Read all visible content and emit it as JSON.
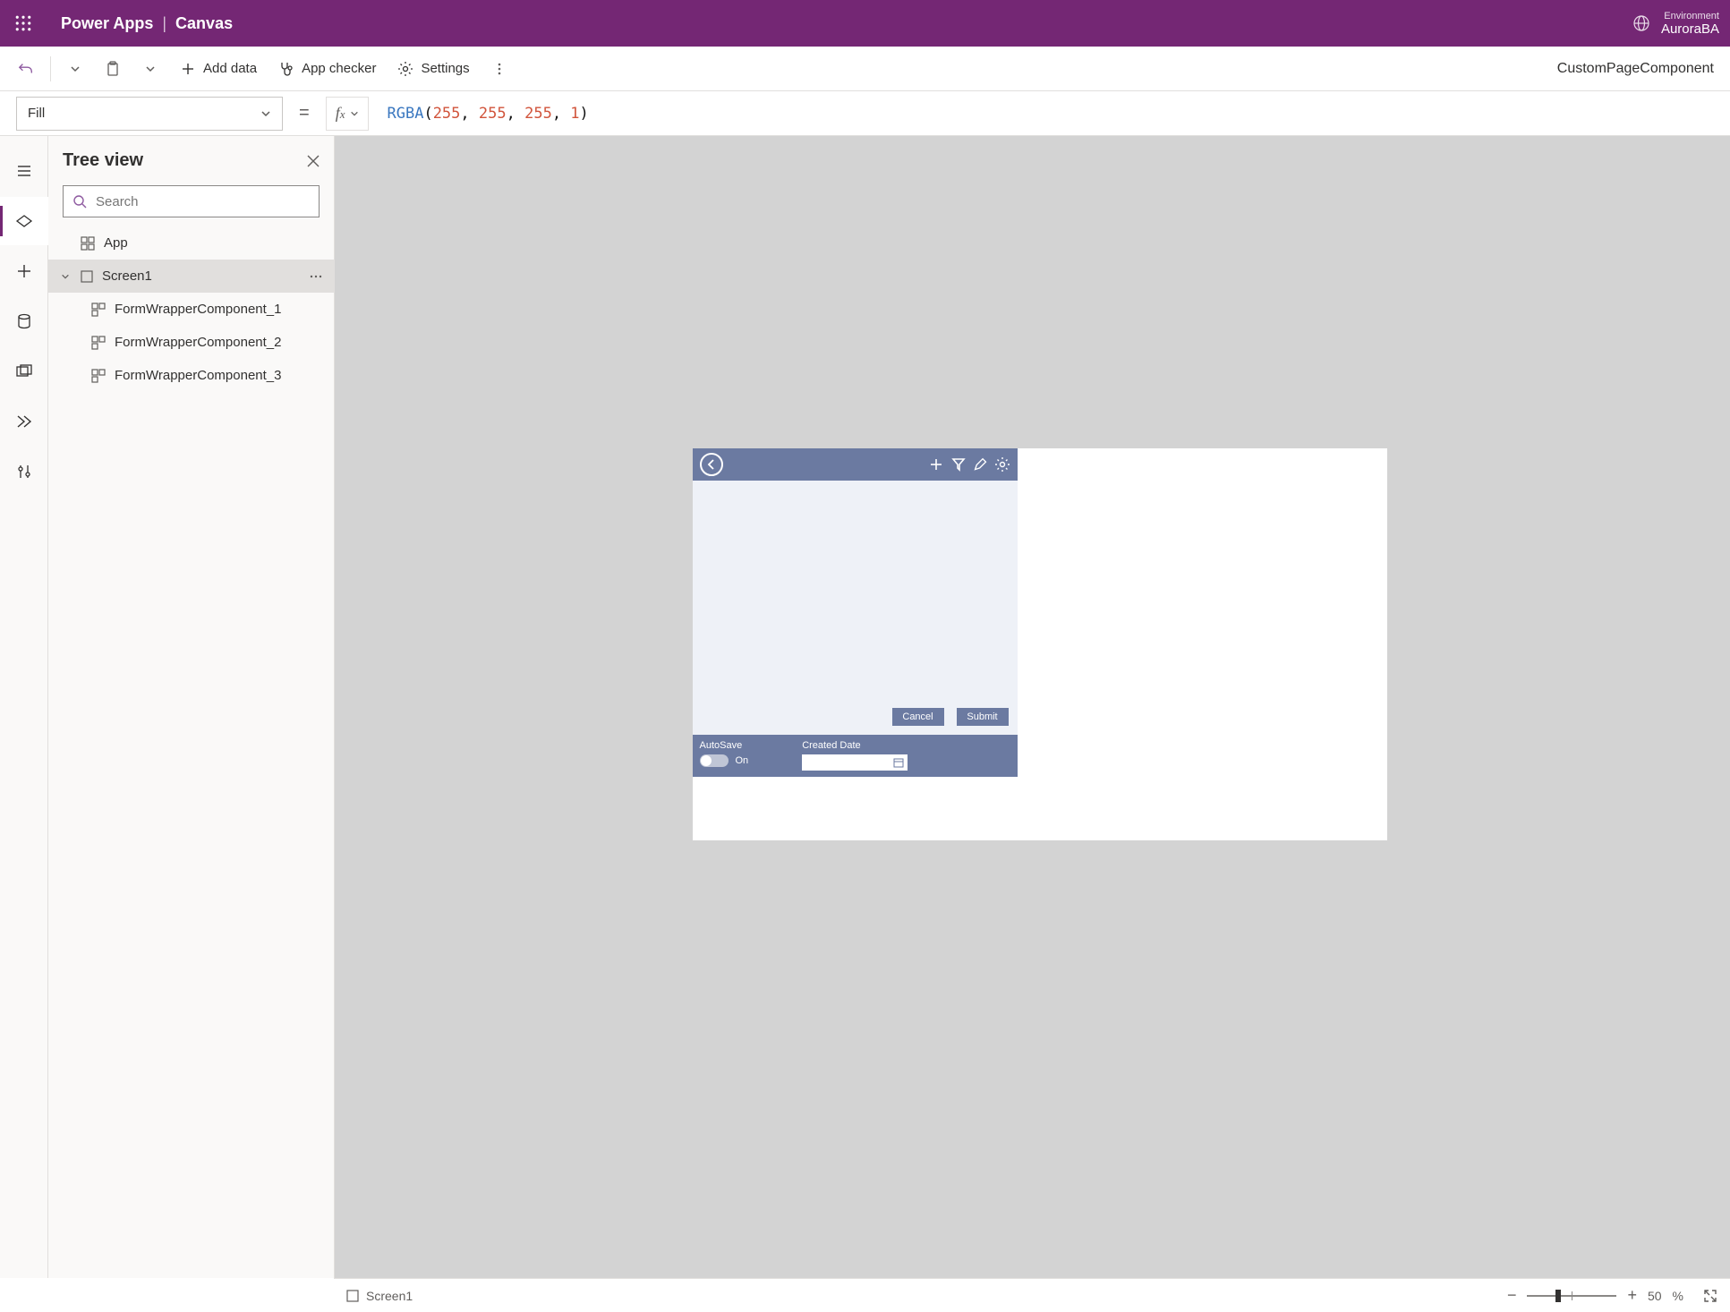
{
  "header": {
    "app_name": "Power Apps",
    "context": "Canvas",
    "env_label": "Environment",
    "env_name": "AuroraBA"
  },
  "commandbar": {
    "add_data": "Add data",
    "app_checker": "App checker",
    "settings": "Settings",
    "doc_name": "CustomPageComponent"
  },
  "formula": {
    "property": "Fill",
    "fn": "RGBA",
    "args": [
      "255",
      "255",
      "255",
      "1"
    ]
  },
  "tree": {
    "title": "Tree view",
    "search_placeholder": "Search",
    "app_node": "App",
    "screen_node": "Screen1",
    "children": [
      "FormWrapperComponent_1",
      "FormWrapperComponent_2",
      "FormWrapperComponent_3"
    ]
  },
  "canvas": {
    "cancel": "Cancel",
    "submit": "Submit",
    "autosave_label": "AutoSave",
    "autosave_state": "On",
    "created_date_label": "Created Date"
  },
  "status": {
    "screen": "Screen1",
    "zoom_value": "50",
    "percent": "%"
  }
}
